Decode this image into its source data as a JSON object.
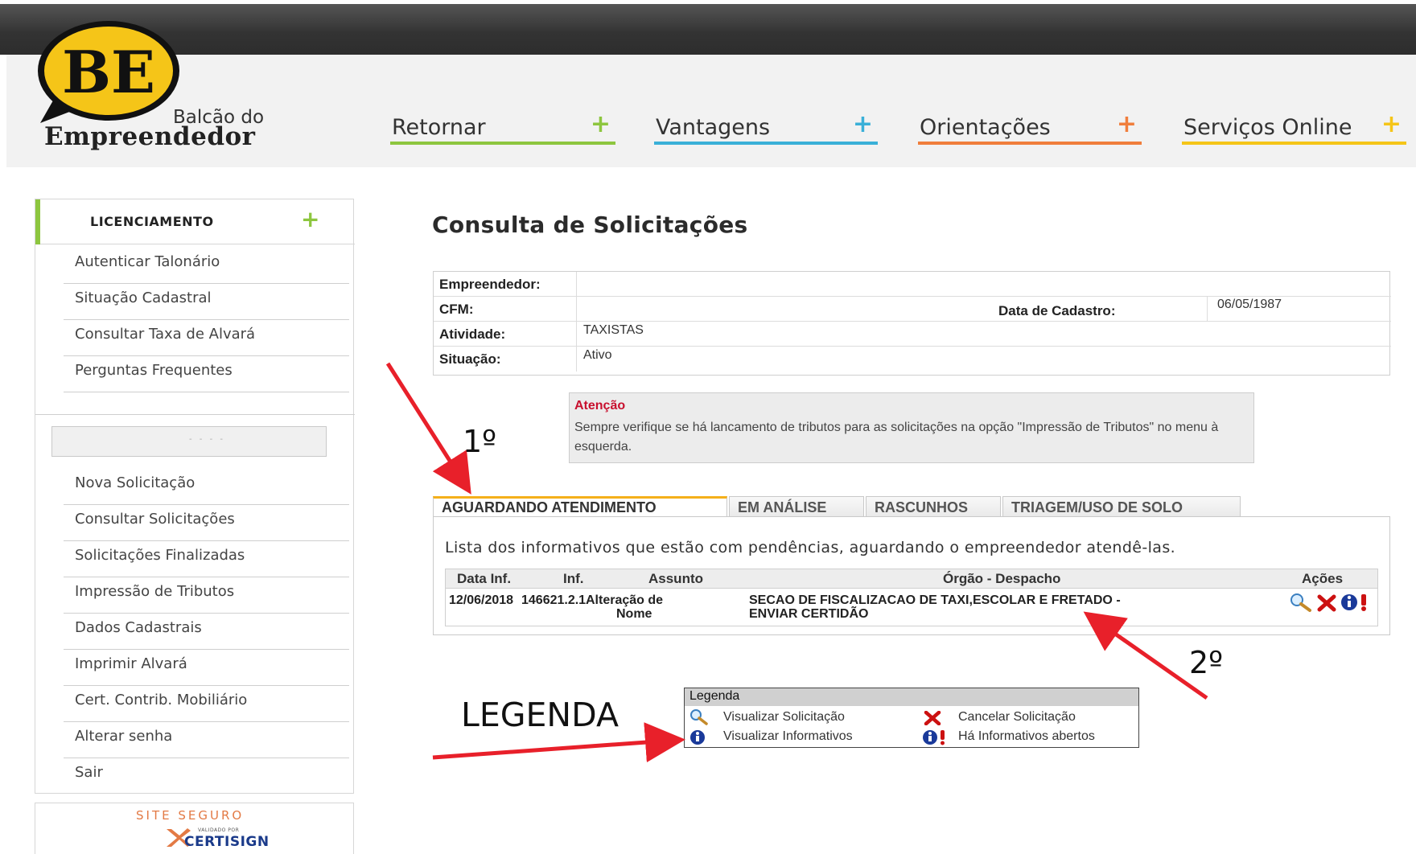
{
  "header": {
    "logo_letters": "BE",
    "logo_line1": "Balcão do",
    "logo_line2": "Empreendedor",
    "nav": [
      {
        "label": "Retornar",
        "plus": "+",
        "color": "#8dc63f"
      },
      {
        "label": "Vantagens",
        "plus": "+",
        "color": "#3ab0d8"
      },
      {
        "label": "Orientações",
        "plus": "+",
        "color": "#f07e3c"
      },
      {
        "label": "Serviços Online",
        "plus": "+",
        "color": "#f5c518"
      }
    ]
  },
  "sidebar": {
    "title": "LICENCIAMENTO",
    "plus": "+",
    "group1": [
      "Autenticar Talonário",
      "Situação Cadastral",
      "Consultar Taxa de Alvará",
      "Perguntas Frequentes"
    ],
    "group2": [
      "Nova Solicitação",
      "Consultar Solicitações",
      "Solicitações Finalizadas",
      "Impressão de Tributos",
      "Dados Cadastrais",
      "Imprimir Alvará",
      "Cert. Contrib. Mobiliário",
      "Alterar senha",
      "Sair"
    ],
    "seal": {
      "line1": "SITE SEGURO",
      "line2": "VALIDADO POR",
      "line3": "CERTISIGN"
    }
  },
  "main": {
    "title": "Consulta de Solicitações",
    "info": {
      "empreendedor_label": "Empreendedor:",
      "empreendedor_value": "",
      "cfm_label": "CFM:",
      "cfm_value": "",
      "data_cadastro_label": "Data de Cadastro:",
      "data_cadastro_value": "06/05/1987",
      "atividade_label": "Atividade:",
      "atividade_value": "TAXISTAS",
      "situacao_label": "Situação:",
      "situacao_value": "Ativo"
    },
    "alert": {
      "title": "Atenção",
      "body": "Sempre verifique se há lancamento de tributos para as solicitações na opção \"Impressão de Tributos\" no menu à esquerda."
    },
    "tabs": [
      "AGUARDANDO ATENDIMENTO",
      "EM ANÁLISE",
      "RASCUNHOS",
      "TRIAGEM/USO DE SOLO"
    ],
    "panel_desc": "Lista dos informativos que estão com pendências, aguardando o empreendedor atendê-las.",
    "table": {
      "columns": [
        "Data Inf.",
        "Inf.",
        "Assunto",
        "Órgão - Despacho",
        "Ações"
      ],
      "rows": [
        {
          "data": "12/06/2018",
          "inf": "146621.2.1",
          "assunto_l1": "Alteração de",
          "assunto_l2": "Nome",
          "orgao_l1": "SECAO DE FISCALIZACAO DE TAXI,ESCOLAR E FRETADO -",
          "orgao_l2": "ENVIAR CERTIDÃO",
          "acoes": [
            "magnifier-icon",
            "cancel-x-icon",
            "info-alert-icon"
          ]
        }
      ]
    },
    "legend": {
      "title": "Legenda",
      "items": [
        {
          "icon": "magnifier-icon",
          "label": "Visualizar Solicitação"
        },
        {
          "icon": "cancel-x-icon",
          "label": "Cancelar Solicitação"
        },
        {
          "icon": "info-icon",
          "label": "Visualizar Informativos"
        },
        {
          "icon": "info-alert-icon",
          "label": "Há Informativos abertos"
        }
      ]
    }
  },
  "annotations": {
    "step1": "1º",
    "step2": "2º",
    "legend_label": "LEGENDA",
    "arrow_color": "#e8202a"
  }
}
